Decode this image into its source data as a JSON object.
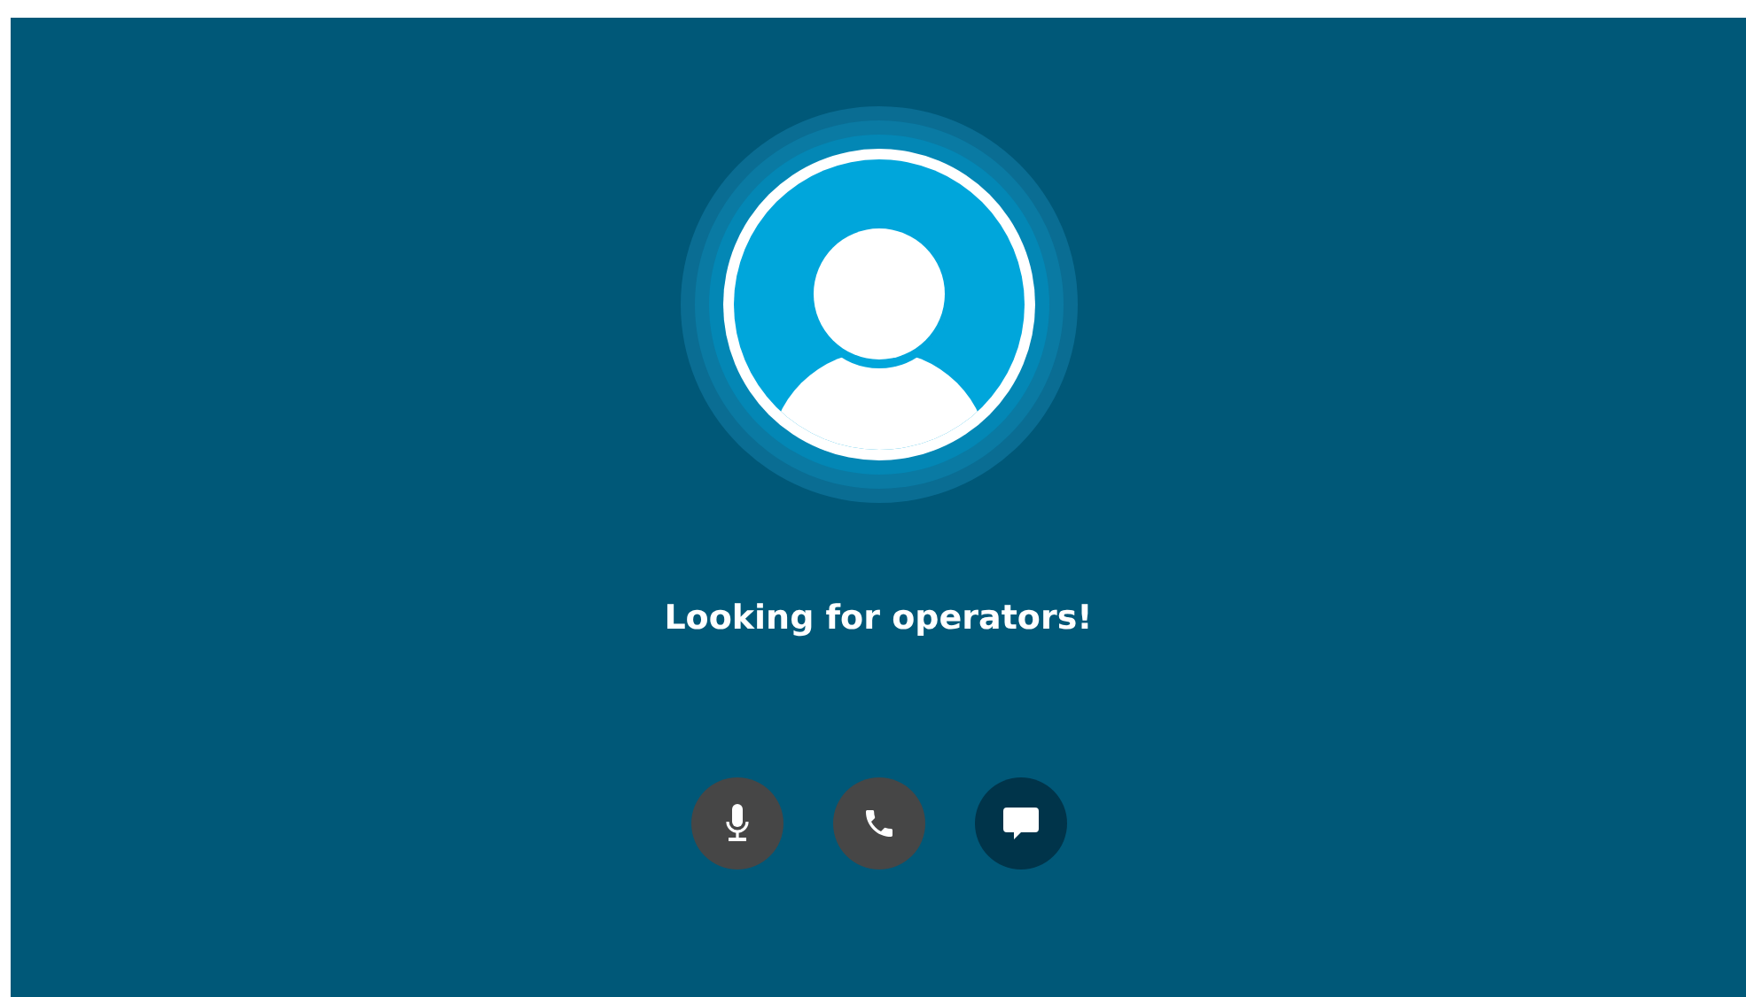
{
  "status": {
    "message": "Looking for operators!"
  },
  "buttons": [
    {
      "kind": "microphone",
      "selected": false
    },
    {
      "kind": "phone",
      "selected": false
    },
    {
      "kind": "chat",
      "selected": true
    }
  ]
}
